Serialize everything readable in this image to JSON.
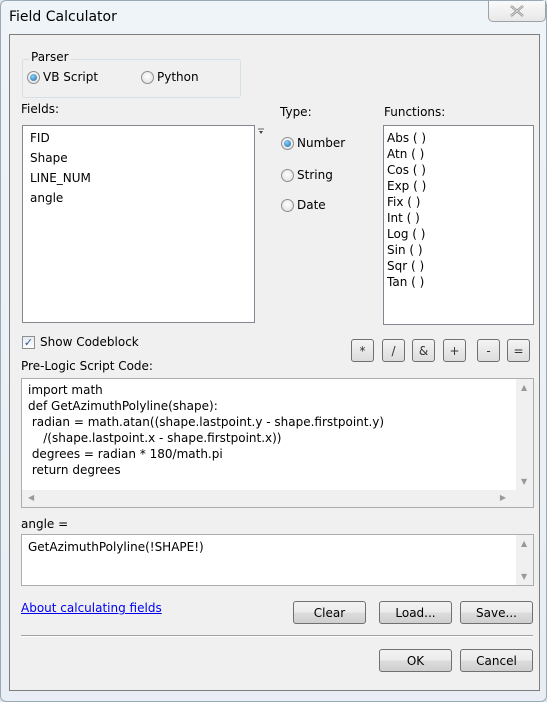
{
  "window": {
    "title": "Field Calculator",
    "close_icon": "close-x-icon"
  },
  "parser": {
    "label": "Parser",
    "options": [
      {
        "label": "VB Script",
        "selected": true
      },
      {
        "label": "Python",
        "selected": false
      }
    ]
  },
  "fields": {
    "label": "Fields:",
    "items": [
      "FID",
      "Shape",
      "LINE_NUM",
      "angle"
    ],
    "sort_icon": "sort-dropdown-icon"
  },
  "type": {
    "label": "Type:",
    "options": [
      {
        "label": "Number",
        "selected": true
      },
      {
        "label": "String",
        "selected": false
      },
      {
        "label": "Date",
        "selected": false
      }
    ]
  },
  "functions": {
    "label": "Functions:",
    "items": [
      "Abs (  )",
      "Atn (  )",
      "Cos (  )",
      "Exp (  )",
      "Fix (  )",
      "Int (  )",
      "Log (  )",
      "Sin (  )",
      "Sqr (  )",
      "Tan (  )"
    ]
  },
  "show_codeblock": {
    "label": "Show Codeblock",
    "checked": true
  },
  "operators": [
    "*",
    "/",
    "&",
    "+",
    "-",
    "="
  ],
  "prelogic": {
    "label": "Pre-Logic Script Code:",
    "lines": [
      "import math",
      "def GetAzimuthPolyline(shape):",
      " radian = math.atan((shape.lastpoint.y - shape.firstpoint.y)",
      "    /(shape.lastpoint.x - shape.firstpoint.x))",
      " degrees = radian * 180/math.pi",
      " return degrees"
    ]
  },
  "expression": {
    "label": "angle =",
    "value": "GetAzimuthPolyline(!SHAPE!)"
  },
  "help_link": "About calculating fields",
  "buttons": {
    "clear": "Clear",
    "load": "Load...",
    "save": "Save...",
    "ok": "OK",
    "cancel": "Cancel"
  }
}
